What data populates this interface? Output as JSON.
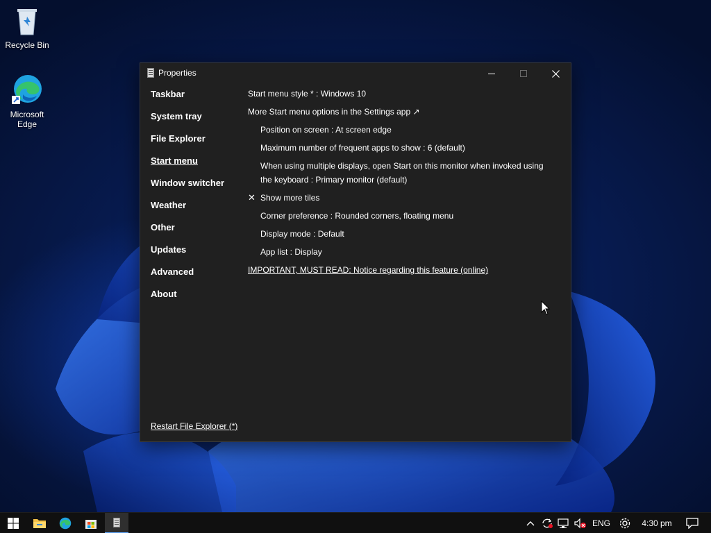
{
  "desktop": {
    "icons": [
      {
        "label": "Recycle Bin"
      },
      {
        "label": "Microsoft Edge"
      }
    ]
  },
  "window": {
    "title": "Properties",
    "nav": [
      {
        "label": "Taskbar"
      },
      {
        "label": "System tray"
      },
      {
        "label": "File Explorer"
      },
      {
        "label": "Start menu",
        "active": true
      },
      {
        "label": "Window switcher"
      },
      {
        "label": "Weather"
      },
      {
        "label": "Other"
      },
      {
        "label": "Updates"
      },
      {
        "label": "Advanced"
      },
      {
        "label": "About"
      }
    ],
    "options": {
      "start_menu_style": "Start menu style * : Windows 10",
      "more_options_link": "More Start menu options in the Settings app ↗",
      "position": "Position on screen : At screen edge",
      "max_frequent": "Maximum number of frequent apps to show : 6 (default)",
      "multi_display": "When using multiple displays, open Start on this monitor when invoked using the keyboard : Primary monitor (default)",
      "show_more_tiles": "Show more tiles",
      "show_more_tiles_mark": "✕",
      "corner_pref": "Corner preference : Rounded corners, floating menu",
      "display_mode": "Display mode : Default",
      "app_list": "App list : Display",
      "important_link": "IMPORTANT, MUST READ: Notice regarding this feature (online)"
    },
    "restart_link": "Restart File Explorer (*)"
  },
  "taskbar": {
    "language": "ENG",
    "time": "4:30 pm"
  },
  "colors": {
    "accent": "#5fa8ff",
    "window_bg": "#202020",
    "taskbar_bg": "#101010"
  }
}
